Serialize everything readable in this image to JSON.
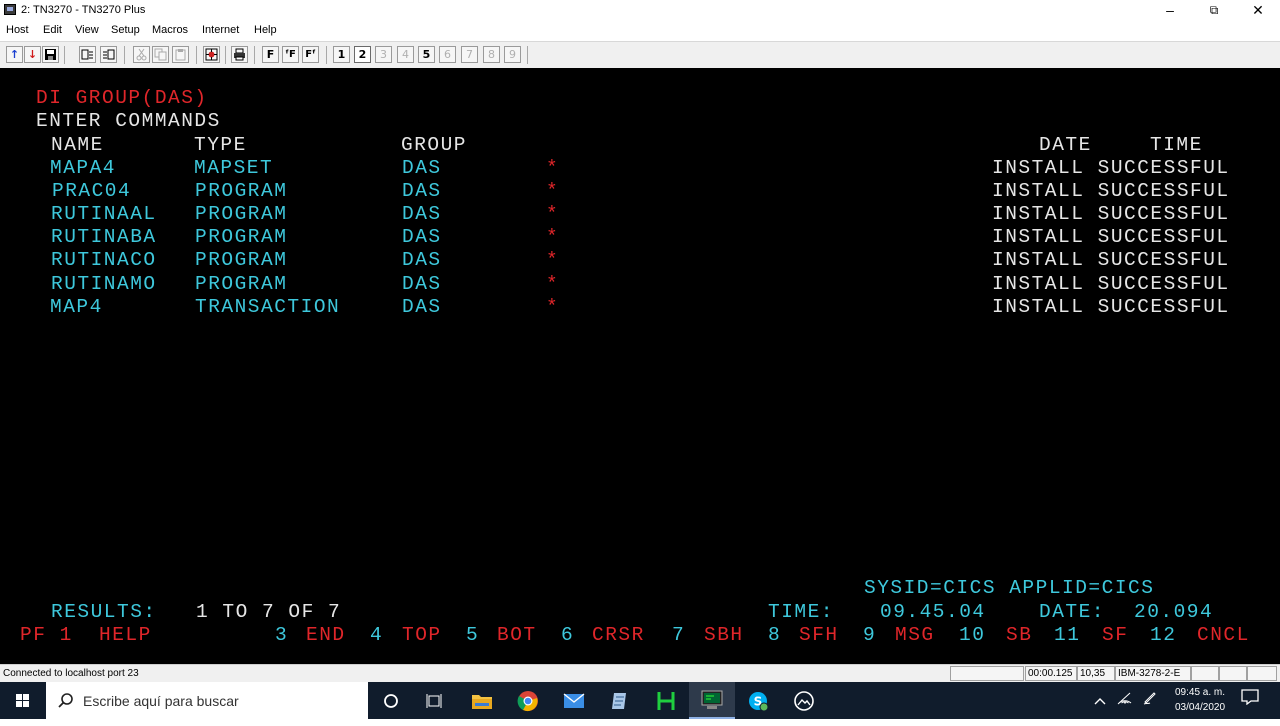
{
  "window": {
    "title": "2: TN3270 - TN3270 Plus",
    "minimize": "–",
    "maximize": "⧉",
    "close": "✕"
  },
  "menu": [
    "Host",
    "Edit",
    "View",
    "Setup",
    "Macros",
    "Internet",
    "Help"
  ],
  "toolbar": {
    "up_icon": "↑",
    "down_icon": "↓",
    "font_buttons": [
      "F",
      "ᶠF",
      "Fᶠ"
    ],
    "sessions": [
      "1",
      "2",
      "3",
      "4",
      "5",
      "6",
      "7",
      "8",
      "9"
    ]
  },
  "terminal": {
    "header": "DI GROUP(DAS)",
    "prompt": "ENTER COMMANDS",
    "columns": {
      "name": "NAME",
      "type": "TYPE",
      "group": "GROUP",
      "date": "DATE",
      "time": "TIME"
    },
    "rows": [
      {
        "name": "MAPA4",
        "type": "MAPSET",
        "group": "DAS",
        "flag": "*",
        "status": "INSTALL SUCCESSFUL"
      },
      {
        "name": "PRAC04",
        "type": "PROGRAM",
        "group": "DAS",
        "flag": "*",
        "status": "INSTALL SUCCESSFUL"
      },
      {
        "name": "RUTINAAL",
        "type": "PROGRAM",
        "group": "DAS",
        "flag": "*",
        "status": "INSTALL SUCCESSFUL"
      },
      {
        "name": "RUTINABA",
        "type": "PROGRAM",
        "group": "DAS",
        "flag": "*",
        "status": "INSTALL SUCCESSFUL"
      },
      {
        "name": "RUTINACO",
        "type": "PROGRAM",
        "group": "DAS",
        "flag": "*",
        "status": "INSTALL SUCCESSFUL"
      },
      {
        "name": "RUTINAMO",
        "type": "PROGRAM",
        "group": "DAS",
        "flag": "*",
        "status": "INSTALL SUCCESSFUL"
      },
      {
        "name": "MAP4",
        "type": "TRANSACTION",
        "group": "DAS",
        "flag": "*",
        "status": "INSTALL SUCCESSFUL"
      }
    ],
    "sysid_line": "SYSID=CICS APPLID=CICS",
    "results": {
      "label": "RESULTS:",
      "value": "1 TO 7 OF 7"
    },
    "time": {
      "label": "TIME:",
      "value": "09.45.04"
    },
    "date": {
      "label": "DATE:",
      "value": "20.094"
    },
    "pf_keys": [
      {
        "num": "PF 1",
        "label": "HELP"
      },
      {
        "num": "3",
        "label": "END"
      },
      {
        "num": "4",
        "label": "TOP"
      },
      {
        "num": "5",
        "label": "BOT"
      },
      {
        "num": "6",
        "label": "CRSR"
      },
      {
        "num": "7",
        "label": "SBH"
      },
      {
        "num": "8",
        "label": "SFH"
      },
      {
        "num": "9",
        "label": "MSG"
      },
      {
        "num": "10",
        "label": "SB"
      },
      {
        "num": "11",
        "label": "SF"
      },
      {
        "num": "12",
        "label": "CNCL"
      }
    ]
  },
  "statusbar": {
    "connection": "Connected to localhost port 23",
    "elapsed": "00:00.125",
    "cursor": "10,35",
    "terminal_type": "IBM-3278-2-E"
  },
  "taskbar": {
    "search_placeholder": "Escribe aquí para buscar",
    "clock_time": "09:45 a. m.",
    "clock_date": "03/04/2020"
  },
  "colors": {
    "terminal_bg": "#000000",
    "red": "#e0262a",
    "cyan": "#3ec8dc",
    "white": "#e6e6e6"
  }
}
